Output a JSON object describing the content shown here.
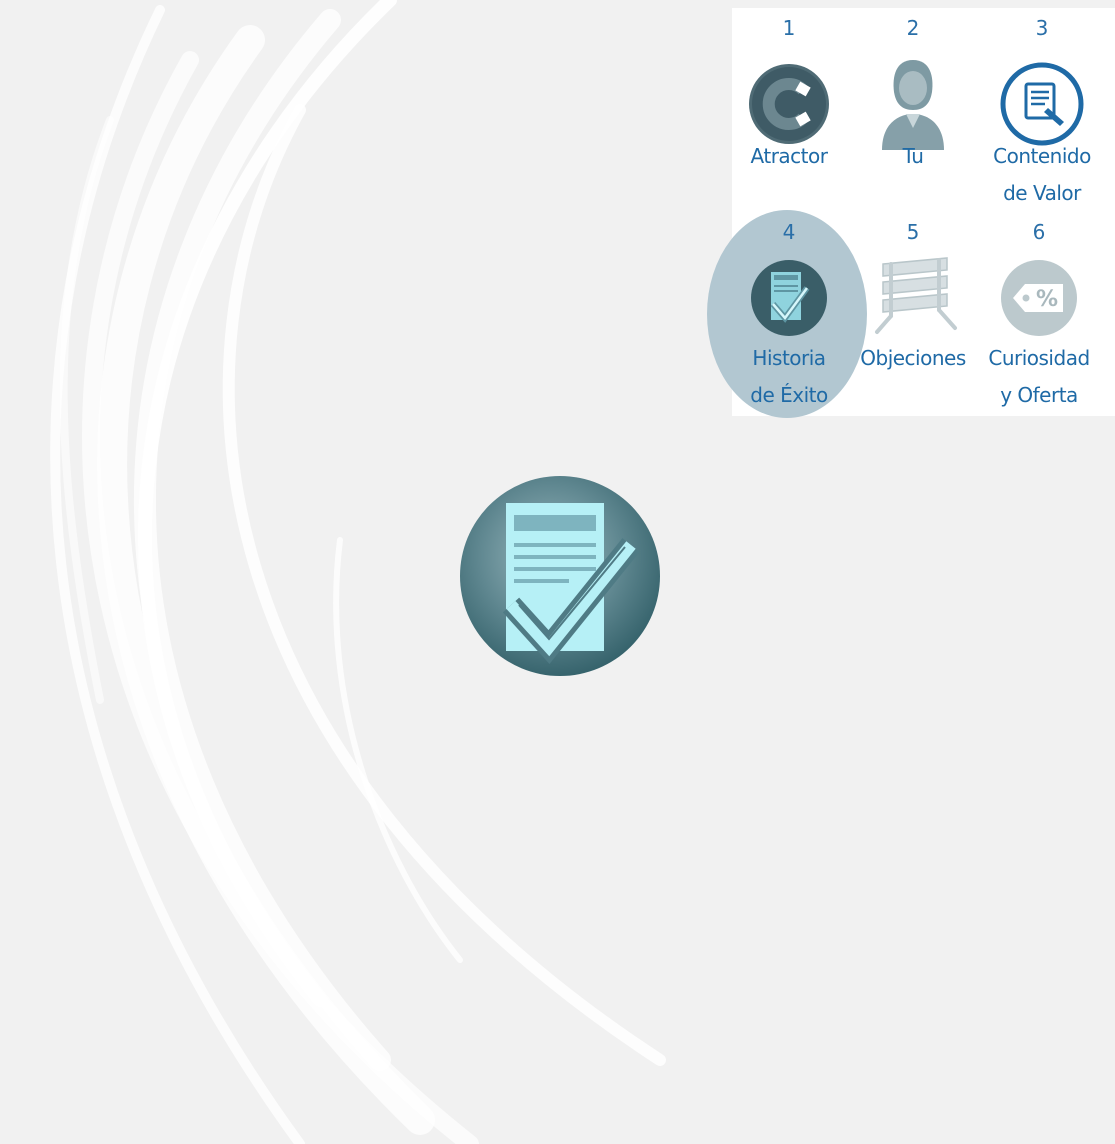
{
  "steps": [
    {
      "number": "1",
      "label_line1": "Atractor",
      "label_line2": "",
      "icon": "magnet-icon"
    },
    {
      "number": "2",
      "label_line1": "Tu",
      "label_line2": "",
      "icon": "person-icon"
    },
    {
      "number": "3",
      "label_line1": "Contenido",
      "label_line2": "de Valor",
      "icon": "document-pen-icon"
    },
    {
      "number": "4",
      "label_line1": "Historia",
      "label_line2": "de Éxito",
      "icon": "document-check-icon"
    },
    {
      "number": "5",
      "label_line1": "Objeciones",
      "label_line2": "",
      "icon": "barrier-icon"
    },
    {
      "number": "6",
      "label_line1": "Curiosidad",
      "label_line2": "y Oferta",
      "icon": "discount-tag-icon"
    }
  ],
  "active_step": "4",
  "colors": {
    "background": "#f1f1f1",
    "panel": "#ffffff",
    "accent_blue": "#1f6aa6",
    "highlight": "#b2c7d1",
    "teal_dark": "#2f5d66",
    "teal_light": "#b6f0f6"
  }
}
